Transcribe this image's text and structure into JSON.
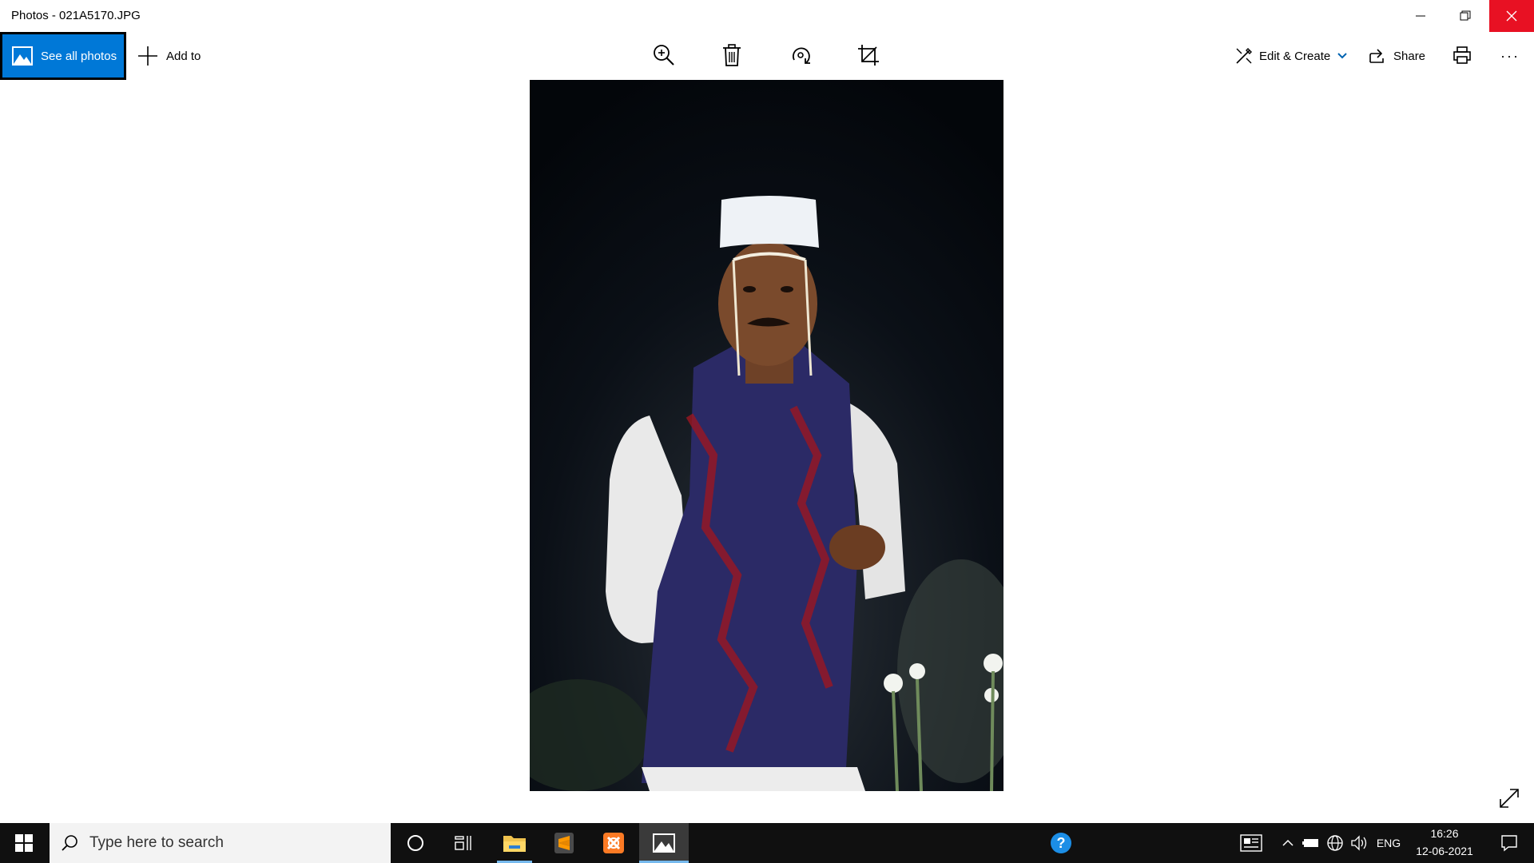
{
  "window": {
    "title": "Photos - 021A5170.JPG"
  },
  "toolbar": {
    "see_all_label": "See all photos",
    "add_to_label": "Add to",
    "edit_create_label": "Edit & Create",
    "share_label": "Share",
    "more_label": "···"
  },
  "photo": {
    "subject": "man-in-white-cap-and-blue-vest"
  },
  "taskbar": {
    "search_placeholder": "Type here to search",
    "language": "ENG",
    "time": "16:26",
    "date": "12-06-2021"
  },
  "colors": {
    "accent": "#0078d7",
    "close_red": "#e81123",
    "taskbar": "#101010"
  }
}
